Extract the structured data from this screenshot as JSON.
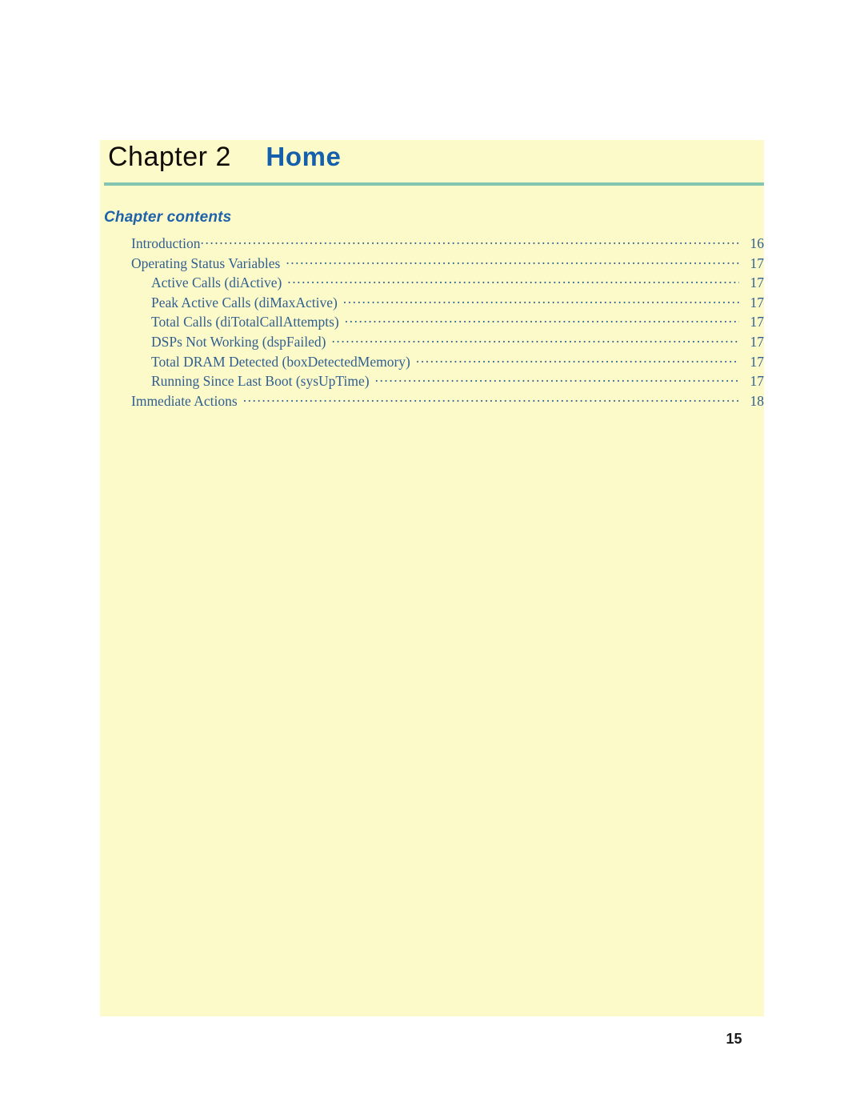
{
  "page": {
    "background_color": "#fdfac9",
    "folio": "15"
  },
  "header": {
    "chapter_word": "Chapter",
    "chapter_number": "2",
    "chapter_title": "Home",
    "rule_color": "#83c5b0",
    "title_color": "#1560ad"
  },
  "contents": {
    "heading": "Chapter contents",
    "heading_color": "#1e62ab",
    "entry_color": "#2f5f91",
    "entries": [
      {
        "label": "Introduction",
        "page": "16",
        "level": 1,
        "gap": false
      },
      {
        "label": "Operating Status Variables",
        "page": "17",
        "level": 1,
        "gap": true
      },
      {
        "label": "Active Calls (diActive)",
        "page": "17",
        "level": 2,
        "gap": true
      },
      {
        "label": "Peak Active Calls (diMaxActive)",
        "page": "17",
        "level": 2,
        "gap": true
      },
      {
        "label": "Total Calls (diTotalCallAttempts)",
        "page": "17",
        "level": 2,
        "gap": true
      },
      {
        "label": "DSPs Not Working (dspFailed)",
        "page": "17",
        "level": 2,
        "gap": true
      },
      {
        "label": "Total DRAM Detected (boxDetectedMemory)",
        "page": "17",
        "level": 2,
        "gap": true
      },
      {
        "label": "Running Since Last Boot (sysUpTime)",
        "page": "17",
        "level": 2,
        "gap": true
      },
      {
        "label": "Immediate Actions",
        "page": "18",
        "level": 1,
        "gap": true
      }
    ]
  }
}
